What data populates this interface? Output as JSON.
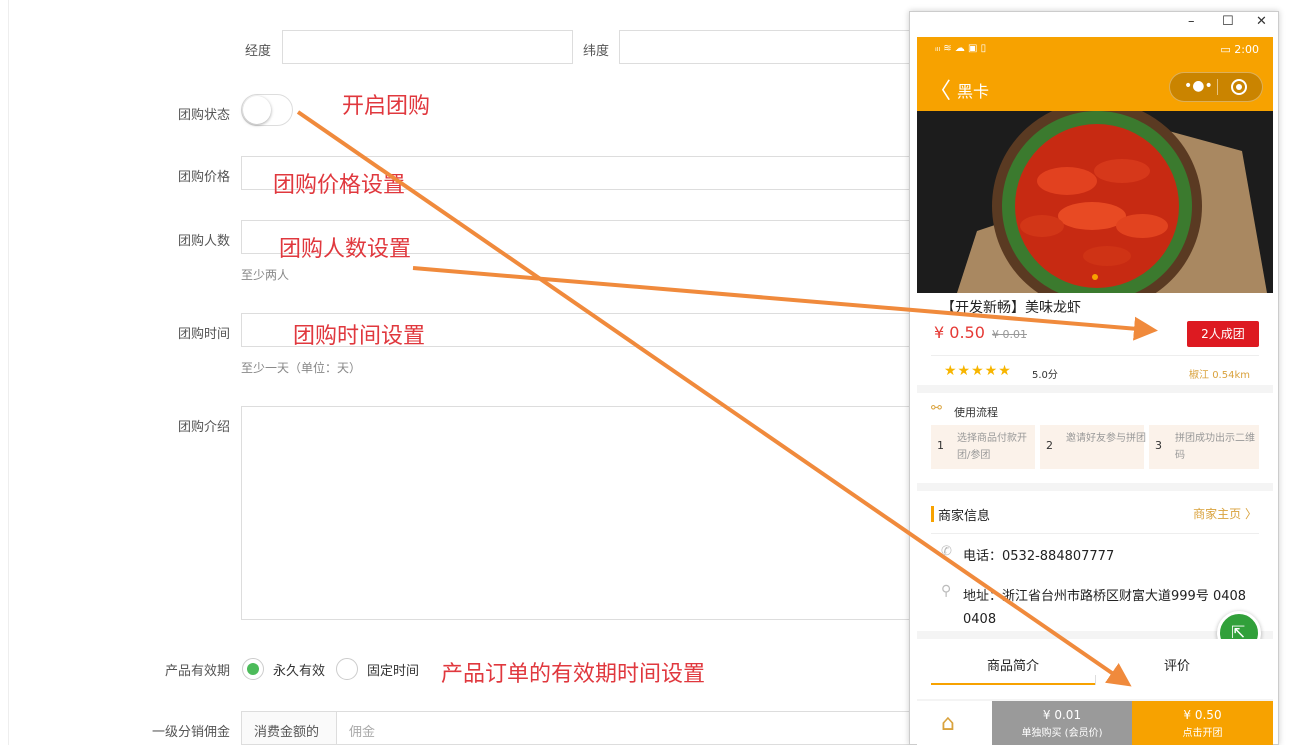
{
  "form": {
    "longitude_label": "经度",
    "latitude_label": "纬度",
    "group_status_label": "团购状态",
    "group_status_on": false,
    "group_price_label": "团购价格",
    "group_size_label": "团购人数",
    "group_size_hint": "至少两人",
    "group_time_label": "团购时间",
    "group_time_hint": "至少一天（单位：天）",
    "group_intro_label": "团购介绍",
    "validity_label": "产品有效期",
    "validity_option_forever": "永久有效",
    "validity_option_fixed": "固定时间",
    "validity_selected": "永久有效",
    "commission_label": "一级分销佣金",
    "commission_prefix": "消费金额的",
    "commission_placeholder": "佣金"
  },
  "annotations": {
    "enable_group": "开启团购",
    "price_setting": "团购价格设置",
    "size_setting": "团购人数设置",
    "time_setting": "团购时间设置",
    "validity_setting": "产品订单的有效期时间设置"
  },
  "annotation_color": "#e0383e",
  "arrow_color": "#f08a3c",
  "window": {
    "minimize": "–",
    "maximize": "☐",
    "close": "✕"
  },
  "phone": {
    "status_left": "ᵢₗₗ ≋ ☁ ▣ ▯",
    "status_right": "▭ 2:00",
    "back": "〈",
    "nav_title": "黑卡",
    "capsule_dots": "•●•",
    "accent": "#f7a200",
    "product": {
      "title": "【开发新畅】美味龙虾",
      "price": "¥ 0.50",
      "original_price": "¥ 0.01",
      "group_button": "2人成团",
      "stars": "★★★★★",
      "score": "5.0分",
      "distance": "椒江 0.54km"
    },
    "flow": {
      "title": "使用流程",
      "steps": [
        {
          "num": "1",
          "text": "选择商品付款开团/参团"
        },
        {
          "num": "2",
          "text": "邀请好友参与拼团"
        },
        {
          "num": "3",
          "text": "拼团成功出示二维码"
        }
      ]
    },
    "merchant": {
      "title": "商家信息",
      "home_link": "商家主页 〉",
      "phone": "电话：0532-884807777",
      "address": "地址：浙江省台州市路桥区财富大道999号 0408 0408"
    },
    "tabs": [
      "商品简介",
      "评价"
    ],
    "footer": {
      "single_price": "¥ 0.01",
      "single_label": "单独购买 (会员价)",
      "group_price": "¥ 0.50",
      "group_label": "点击开团"
    }
  }
}
